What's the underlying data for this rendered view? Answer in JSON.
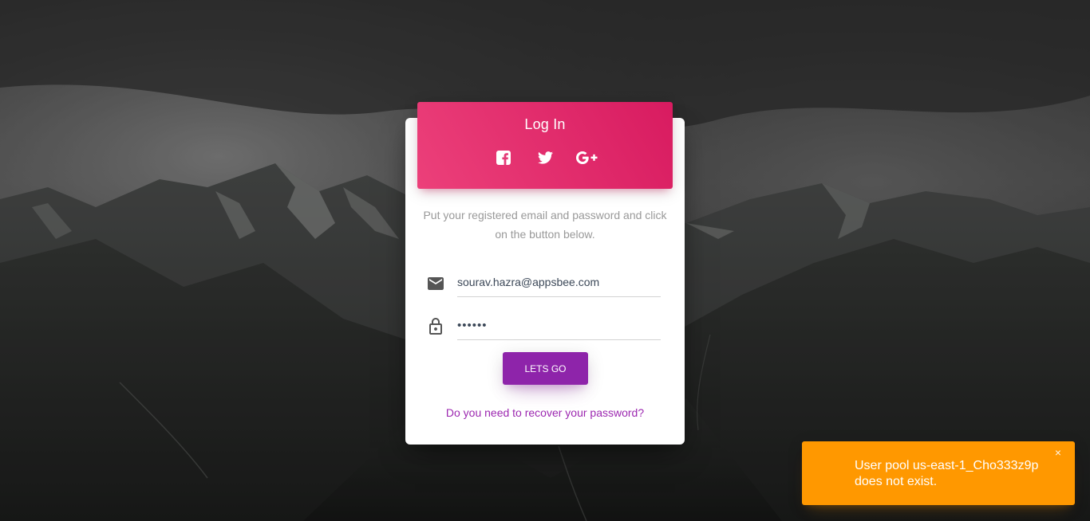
{
  "login": {
    "title": "Log In",
    "social": [
      {
        "icon": "facebook-icon"
      },
      {
        "icon": "twitter-icon"
      },
      {
        "icon": "google-plus-icon"
      }
    ],
    "description": "Put your registered email and password and click on the button below.",
    "email": {
      "value": "sourav.hazra@appsbee.com",
      "icon": "email-icon"
    },
    "password": {
      "value": "••••••",
      "icon": "lock-icon"
    },
    "submit_label": "LETS GO",
    "recover_link": "Do you need to recover your password?"
  },
  "toast": {
    "message": "User pool us-east-1_Cho333z9p does not exist.",
    "close_label": "×"
  },
  "colors": {
    "header_gradient_start": "#ec407a",
    "header_gradient_end": "#d81b60",
    "button": "#8e24aa",
    "link": "#9c27b0",
    "toast": "#ff9800"
  }
}
